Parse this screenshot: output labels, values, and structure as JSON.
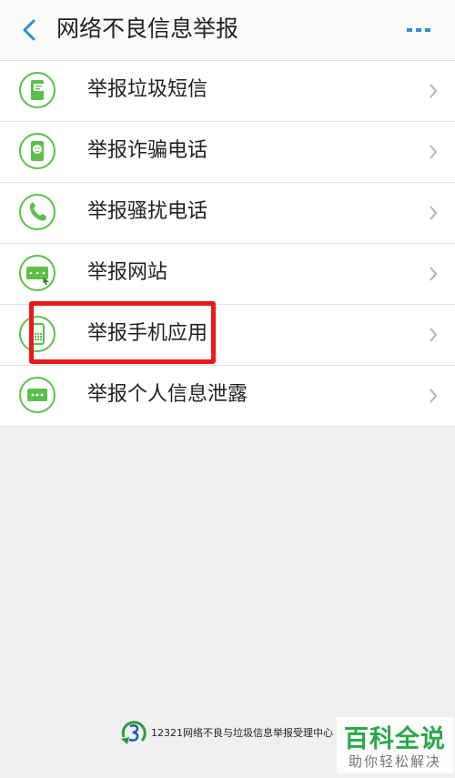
{
  "header": {
    "title": "网络不良信息举报",
    "back_icon": "chevron-left-icon",
    "more_icon": "more-dots-icon"
  },
  "menu": {
    "items": [
      {
        "label": "举报垃圾短信",
        "icon": "sms-phone-icon"
      },
      {
        "label": "举报诈骗电话",
        "icon": "scam-phone-icon"
      },
      {
        "label": "举报骚扰电话",
        "icon": "handset-icon"
      },
      {
        "label": "举报网站",
        "icon": "www-icon"
      },
      {
        "label": "举报手机应用",
        "icon": "mobile-app-icon"
      },
      {
        "label": "举报个人信息泄露",
        "icon": "chat-dots-icon"
      }
    ]
  },
  "footer": {
    "text": "12321网络不良与垃圾信息举报受理中心"
  },
  "watermark": {
    "title": "百科全说",
    "subtitle": "助你轻松解决"
  },
  "colors": {
    "accent_blue": "#2b8fd6",
    "icon_green": "#5cbf4a",
    "highlight_red": "#e8191b"
  }
}
